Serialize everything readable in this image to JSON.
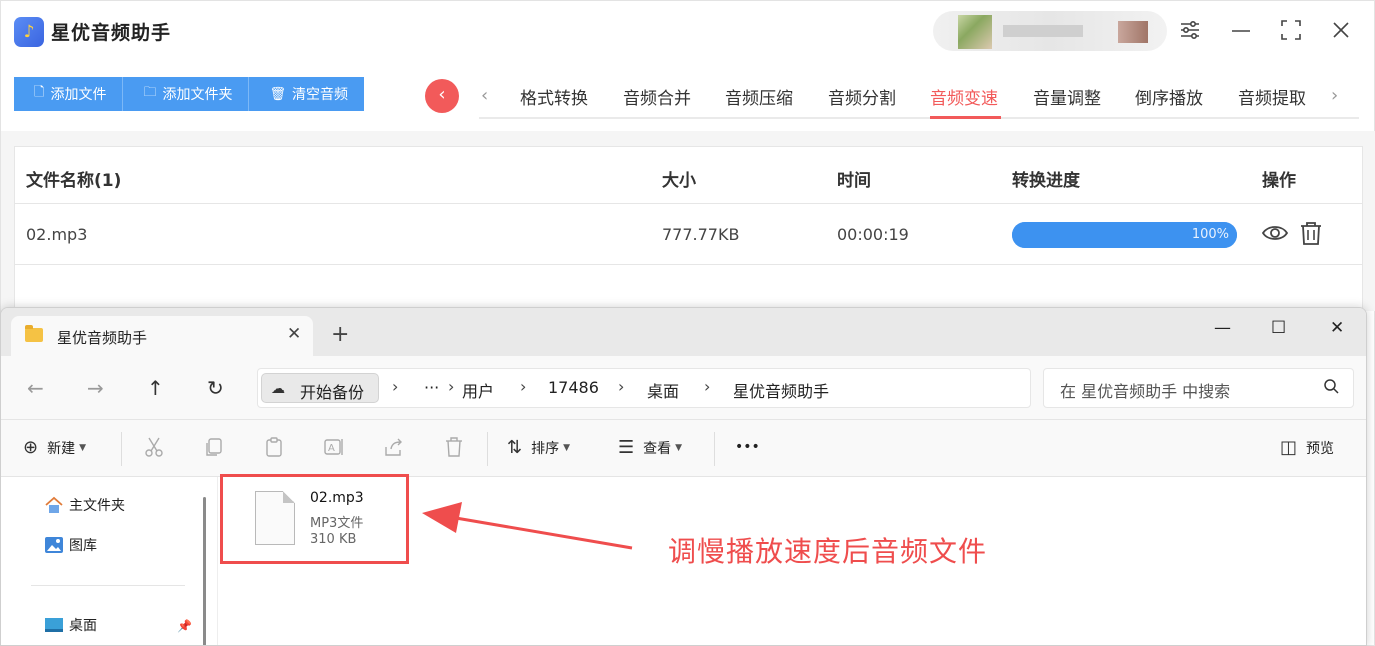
{
  "app": {
    "title": "星优音频助手",
    "logo_glyph": "♪",
    "window_controls": {
      "settings": "⚙",
      "minimize": "—",
      "maximize": "⛶",
      "close": "✕"
    }
  },
  "toolbar": {
    "add_file": "添加文件",
    "add_folder": "添加文件夹",
    "clear_audio": "清空音频"
  },
  "tabs": {
    "items": [
      "格式转换",
      "音频合并",
      "音频压缩",
      "音频分割",
      "音频变速",
      "音量调整",
      "倒序播放",
      "音频提取"
    ],
    "active": "音频变速"
  },
  "table": {
    "headers": {
      "name": "文件名称(1)",
      "size": "大小",
      "time": "时间",
      "progress": "转换进度",
      "ops": "操作"
    },
    "rows": [
      {
        "name": "02.mp3",
        "size": "777.77KB",
        "time": "00:00:19",
        "progress_text": "100%",
        "progress": 1.0
      }
    ]
  },
  "explorer": {
    "tab_title": "星优音频助手",
    "breadcrumb": {
      "pill": "开始备份",
      "ellipsis": "···",
      "items": [
        "用户",
        "17486",
        "桌面",
        "星优音频助手"
      ]
    },
    "search_placeholder": "在 星优音频助手 中搜索",
    "commands": {
      "new": "新建",
      "sort": "排序",
      "view": "查看",
      "more": "•••",
      "preview": "预览"
    },
    "sidebar": {
      "home": "主文件夹",
      "gallery": "图库",
      "desktop": "桌面"
    },
    "file": {
      "name": "02.mp3",
      "type": "MP3文件",
      "size": "310 KB"
    }
  },
  "annotation": {
    "callout": "调慢播放速度后音频文件",
    "color": "#ef4d4d"
  },
  "colors": {
    "accent_blue": "#4a9bf2",
    "accent_red": "#f25a5a"
  }
}
